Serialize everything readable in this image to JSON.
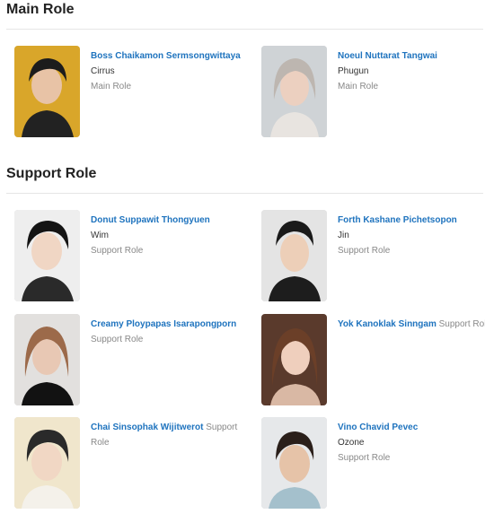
{
  "sections": [
    {
      "title": "Main Role",
      "cast": [
        {
          "name": "Boss Chaikamon Sermsongwittaya",
          "character": "Cirrus",
          "role": "Main Role"
        },
        {
          "name": "Noeul Nuttarat Tangwai",
          "character": "Phugun",
          "role": "Main Role"
        }
      ]
    },
    {
      "title": "Support Role",
      "cast": [
        {
          "name": "Donut Suppawit Thongyuen",
          "character": "Wim",
          "role": "Support Role"
        },
        {
          "name": "Forth Kashane Pichetsopon",
          "character": "Jin",
          "role": "Support Role"
        },
        {
          "name": "Creamy Ploypapas Isarapongporn",
          "character": "",
          "role": "Support Role"
        },
        {
          "name": "Yok Kanoklak Sinngam",
          "character": "",
          "role": "Support Role"
        },
        {
          "name": "Chai Sinsophak Wijitwerot",
          "character": "",
          "role": "Support Role"
        },
        {
          "name": "Vino Chavid Pevec",
          "character": "Ozone",
          "role": "Support Role"
        }
      ]
    }
  ],
  "colors": {
    "link": "#1e73be",
    "role": "#888888",
    "divider": "#e6e6e6"
  }
}
